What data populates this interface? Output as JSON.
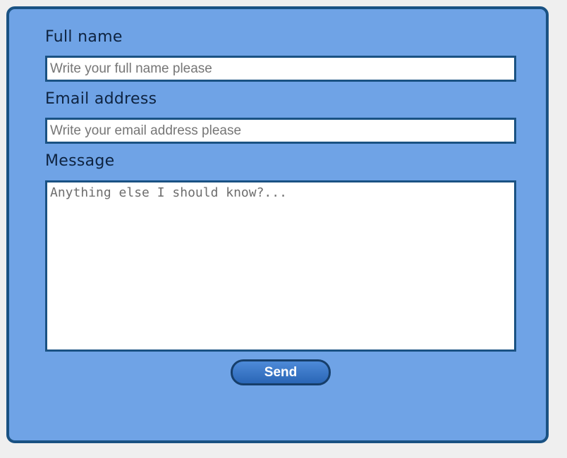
{
  "form": {
    "fullname": {
      "label": "Full name",
      "placeholder": "Write your full name please",
      "value": ""
    },
    "email": {
      "label": "Email address",
      "placeholder": "Write your email address please",
      "value": ""
    },
    "message": {
      "label": "Message",
      "placeholder": "Anything else I should know?...",
      "value": ""
    },
    "send_label": "Send"
  },
  "colors": {
    "panel_background": "#6fa3e6",
    "panel_border": "#1a5283",
    "page_background": "#efefef",
    "button_gradient_top": "#4d8ad8",
    "button_gradient_bottom": "#2a66b6"
  }
}
